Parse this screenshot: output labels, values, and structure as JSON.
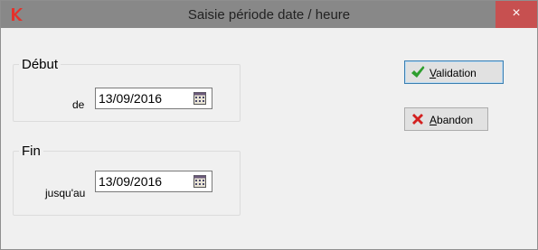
{
  "window": {
    "title": "Saisie période date / heure",
    "close_glyph": "×"
  },
  "debut": {
    "legend": "Début",
    "label": "de",
    "value": "13/09/2016"
  },
  "fin": {
    "legend": "Fin",
    "label": "jusqu'au",
    "value": "13/09/2016"
  },
  "buttons": {
    "validation": {
      "mnemonic": "V",
      "rest": "alidation",
      "icon": "check-icon",
      "icon_color": "#2e9e2e"
    },
    "abandon": {
      "mnemonic": "A",
      "rest": "bandon",
      "icon": "cross-icon",
      "icon_color": "#d3201f"
    }
  },
  "colors": {
    "titlebar": "#888888",
    "close_button": "#c75050",
    "app_icon": "#e5312a"
  }
}
